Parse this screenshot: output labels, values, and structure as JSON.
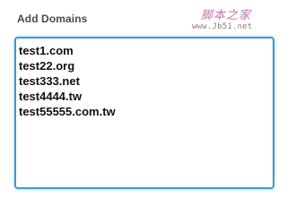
{
  "form": {
    "label": "Add Domains",
    "domains": [
      "test1.com",
      "test22.org",
      "test333.net",
      "test4444.tw",
      "test55555.com.tw"
    ]
  },
  "watermark": {
    "title": "脚本之家",
    "url": "www.Jb51.net"
  },
  "colors": {
    "focus_border": "#3d9ad6",
    "label_text": "#4a4a4a",
    "watermark": "#b05aa0"
  }
}
